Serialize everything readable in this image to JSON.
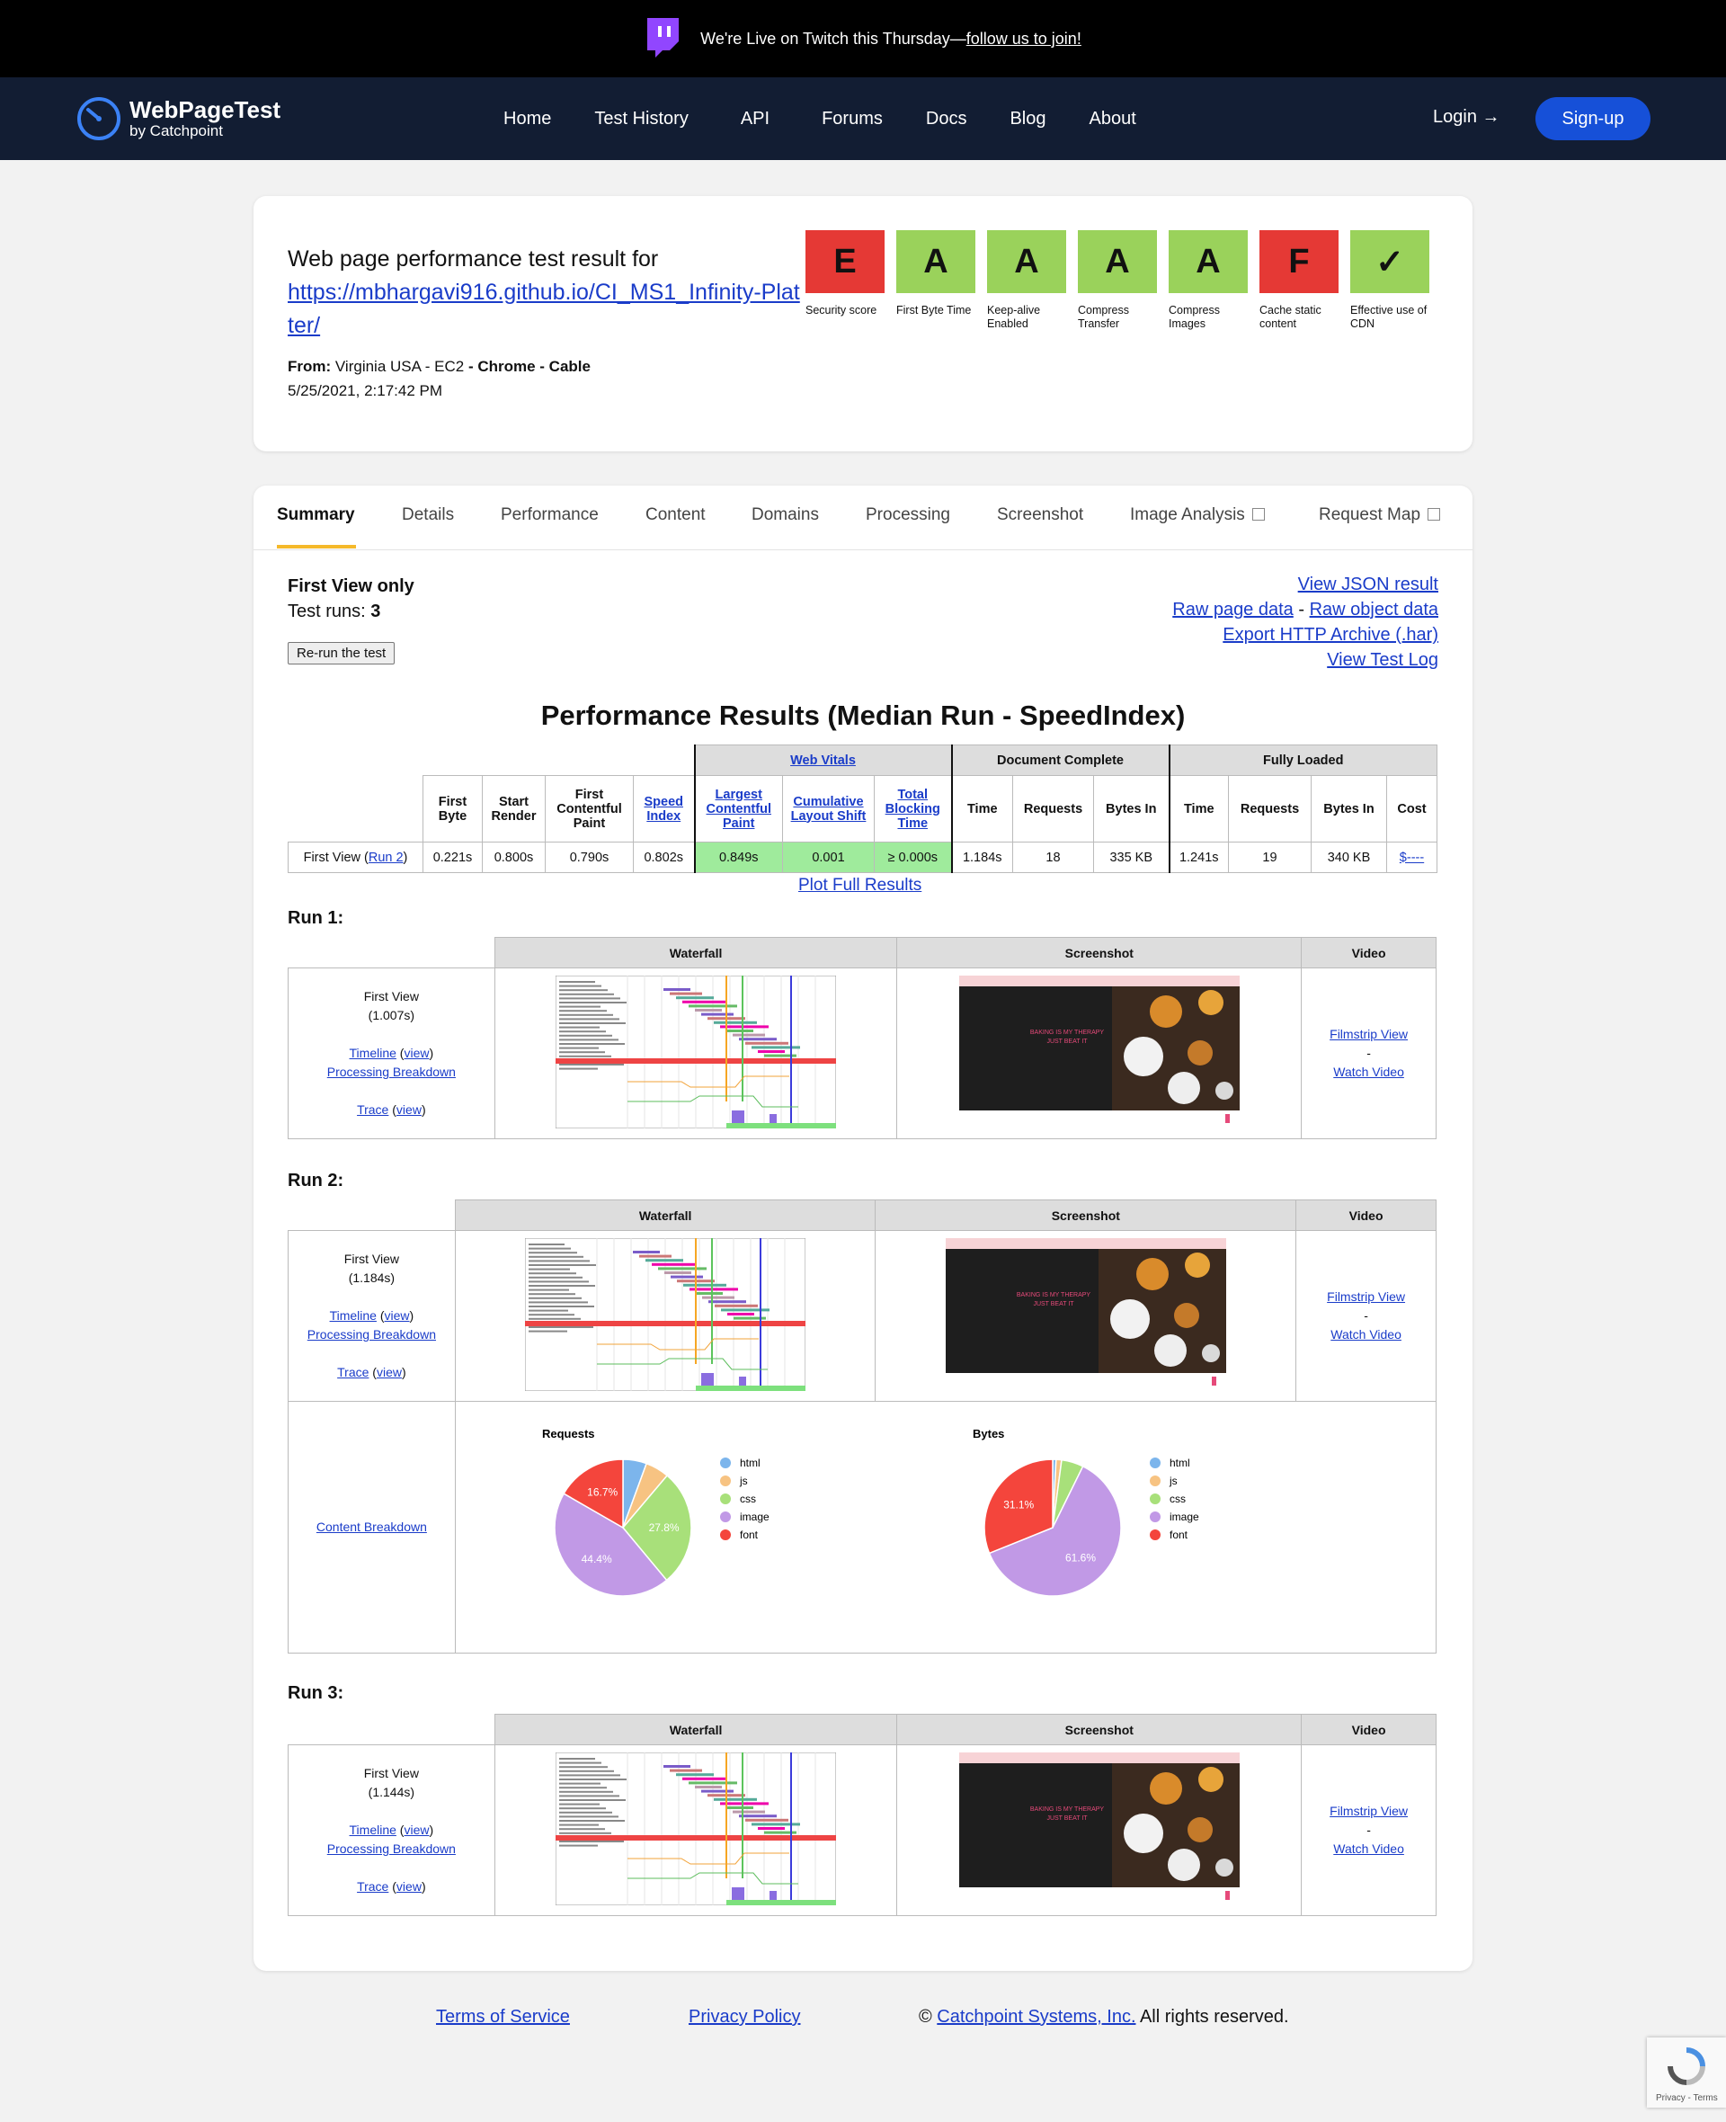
{
  "promo": {
    "text": "We're Live on Twitch this Thursday—",
    "link": "follow us to join!"
  },
  "brand": {
    "title": "WebPageTest",
    "subtitle": "by Catchpoint"
  },
  "nav": {
    "home": "Home",
    "history": "Test History",
    "api": "API",
    "forums": "Forums",
    "docs": "Docs",
    "blog": "Blog",
    "about": "About",
    "login": "Login",
    "signup": "Sign-up"
  },
  "result": {
    "heading": "Web page performance test result for",
    "url_line1": "https://mbhargavi916.github.io/CI_MS1_Infinity-Plat",
    "url_line2": "ter/",
    "from_label": "From:",
    "from_location": " Virginia USA - EC2 ",
    "from_dash1": "- ",
    "browser": "Chrome",
    "from_dash2": " - ",
    "connection": "Cable",
    "date": "5/25/2021, 2:17:42 PM"
  },
  "grades": [
    {
      "grade": "E",
      "label": "Security score",
      "color": "#e53935"
    },
    {
      "grade": "A",
      "label": "First Byte Time",
      "color": "#9ad25b"
    },
    {
      "grade": "A",
      "label": "Keep-alive Enabled",
      "color": "#9ad25b"
    },
    {
      "grade": "A",
      "label": "Compress Transfer",
      "color": "#9ad25b"
    },
    {
      "grade": "A",
      "label": "Compress Images",
      "color": "#9ad25b"
    },
    {
      "grade": "F",
      "label": "Cache static content",
      "color": "#e53935"
    },
    {
      "grade": "✓",
      "label": "Effective use of CDN",
      "color": "#9ad25b"
    }
  ],
  "tabs": {
    "summary": "Summary",
    "details": "Details",
    "performance": "Performance",
    "content": "Content",
    "domains": "Domains",
    "processing": "Processing",
    "screenshot": "Screenshot",
    "image_analysis": "Image Analysis",
    "request_map": "Request Map"
  },
  "summary": {
    "first_view_only": "First View only",
    "test_runs_label": "Test runs: ",
    "test_runs": "3",
    "rerun": "Re-run the test",
    "view_json": "View JSON result",
    "raw_page": "Raw page data",
    "raw_sep": " - ",
    "raw_object": "Raw object data",
    "export_har": "Export HTTP Archive (.har)",
    "view_log": "View Test Log",
    "perf_title": "Performance Results (Median Run - SpeedIndex)",
    "plot_full": "Plot Full Results"
  },
  "perf_table": {
    "group_web_vitals": "Web Vitals",
    "group_doc_complete": "Document Complete",
    "group_fully_loaded": "Fully Loaded",
    "h_first_byte": "First Byte",
    "h_start_render": "Start Render",
    "h_fcp": "First Contentful Paint",
    "h_speed_index": "Speed Index",
    "h_lcp": "Largest Contentful Paint",
    "h_cls": "Cumulative Layout Shift",
    "h_tbt": "Total Blocking Time",
    "h_time": "Time",
    "h_requests": "Requests",
    "h_bytes": "Bytes In",
    "h_cost": "Cost",
    "row_label": "First View (",
    "row_run_link": "Run 2",
    "row_label_end": ")",
    "first_byte": "0.221s",
    "start_render": "0.800s",
    "fcp": "0.790s",
    "speed_index": "0.802s",
    "lcp": "0.849s",
    "cls": "0.001",
    "tbt": "≥ 0.000s",
    "dc_time": "1.184s",
    "dc_requests": "18",
    "dc_bytes": "335 KB",
    "fl_time": "1.241s",
    "fl_requests": "19",
    "fl_bytes": "340 KB",
    "cost": "$----"
  },
  "runs": [
    {
      "title": "Run 1:",
      "view": "First View",
      "time": "(1.007s)"
    },
    {
      "title": "Run 2:",
      "view": "First View",
      "time": "(1.184s)"
    },
    {
      "title": "Run 3:",
      "view": "First View",
      "time": "(1.144s)"
    }
  ],
  "run_common": {
    "col_waterfall": "Waterfall",
    "col_screenshot": "Screenshot",
    "col_video": "Video",
    "timeline": "Timeline",
    "view": "view",
    "processing": "Processing Breakdown",
    "trace": "Trace",
    "filmstrip": "Filmstrip View",
    "dash": "-",
    "watch_video": "Watch Video",
    "content_breakdown": "Content Breakdown",
    "shot_text_1": "BAKING IS MY THERAPY",
    "shot_text_2": "JUST BEAT IT"
  },
  "chart_data": [
    {
      "type": "pie",
      "title": "Requests",
      "categories": [
        "html",
        "js",
        "css",
        "image",
        "font"
      ],
      "values": [
        5.6,
        5.6,
        27.8,
        44.4,
        16.7
      ],
      "colors": [
        "#7cb5ec",
        "#f7c382",
        "#a8e07a",
        "#c199e6",
        "#f4453c"
      ],
      "labels": [
        "",
        "",
        "27.8%",
        "44.4%",
        "16.7%"
      ]
    },
    {
      "type": "pie",
      "title": "Bytes",
      "categories": [
        "html",
        "js",
        "css",
        "image",
        "font"
      ],
      "values": [
        0.8,
        1.3,
        5.2,
        61.6,
        31.1
      ],
      "colors": [
        "#7cb5ec",
        "#f7c382",
        "#a8e07a",
        "#c199e6",
        "#f4453c"
      ],
      "labels": [
        "",
        "",
        "",
        "61.6%",
        "31.1%"
      ]
    }
  ],
  "footer": {
    "terms": "Terms of Service",
    "privacy": "Privacy Policy",
    "copyright": "© ",
    "company": "Catchpoint Systems, Inc.",
    "rights": " All rights reserved."
  },
  "recaptcha": {
    "text": "Privacy - Terms"
  }
}
